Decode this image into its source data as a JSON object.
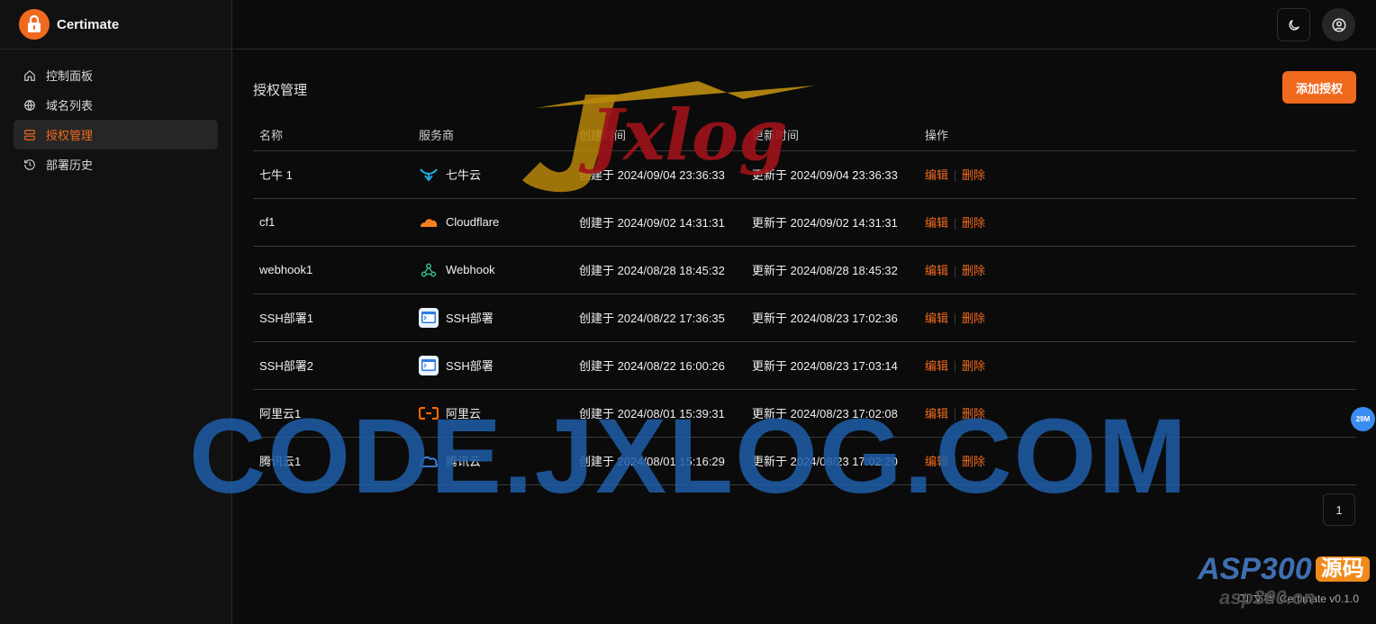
{
  "app": {
    "name": "Certimate"
  },
  "sidebar": {
    "items": [
      {
        "label": "控制面板",
        "icon": "home-icon",
        "active": false
      },
      {
        "label": "域名列表",
        "icon": "globe-icon",
        "active": false
      },
      {
        "label": "授权管理",
        "icon": "server-icon",
        "active": true
      },
      {
        "label": "部署历史",
        "icon": "history-icon",
        "active": false
      }
    ]
  },
  "header": {
    "theme_icon": "moon-icon",
    "user_icon": "user-circle-icon"
  },
  "main": {
    "title": "授权管理",
    "add_button": "添加授权",
    "columns": [
      "名称",
      "服务商",
      "创建时间",
      "更新时间",
      "操作"
    ],
    "rows": [
      {
        "name": "七牛 1",
        "provider": "七牛云",
        "provider_icon": "qiniu-icon",
        "created": "创建于 2024/09/04 23:36:33",
        "updated": "更新于 2024/09/04 23:36:33"
      },
      {
        "name": "cf1",
        "provider": "Cloudflare",
        "provider_icon": "cloudflare-icon",
        "created": "创建于 2024/09/02 14:31:31",
        "updated": "更新于 2024/09/02 14:31:31"
      },
      {
        "name": "webhook1",
        "provider": "Webhook",
        "provider_icon": "webhook-icon",
        "created": "创建于 2024/08/28 18:45:32",
        "updated": "更新于 2024/08/28 18:45:32"
      },
      {
        "name": "SSH部署1",
        "provider": "SSH部署",
        "provider_icon": "ssh-icon",
        "created": "创建于 2024/08/22 17:36:35",
        "updated": "更新于 2024/08/23 17:02:36"
      },
      {
        "name": "SSH部署2",
        "provider": "SSH部署",
        "provider_icon": "ssh-icon",
        "created": "创建于 2024/08/22 16:00:26",
        "updated": "更新于 2024/08/23 17:03:14"
      },
      {
        "name": "阿里云1",
        "provider": "阿里云",
        "provider_icon": "aliyun-icon",
        "created": "创建于 2024/08/01 15:39:31",
        "updated": "更新于 2024/08/23 17:02:08"
      },
      {
        "name": "腾讯云1",
        "provider": "腾讯云",
        "provider_icon": "tencent-cloud-icon",
        "created": "创建于 2024/08/01 15:16:29",
        "updated": "更新于 2024/08/23 17:02:20"
      }
    ],
    "actions": {
      "edit": "编辑",
      "delete": "删除"
    },
    "pagination": {
      "current": "1"
    }
  },
  "footer": {
    "doc_label": "文档",
    "version": "Certimate v0.1.0"
  },
  "float_badge": "29M",
  "watermarks": {
    "center": "CODE.JXLOG.COM",
    "logo": "Jxlog",
    "corner_main": "ASP300",
    "corner_tag": "源码",
    "corner_sub": "asp300.cn"
  },
  "colors": {
    "accent": "#f06a1e",
    "background": "#0b0b0b",
    "sidebar": "#111111",
    "badge": "#3b8cf0"
  }
}
